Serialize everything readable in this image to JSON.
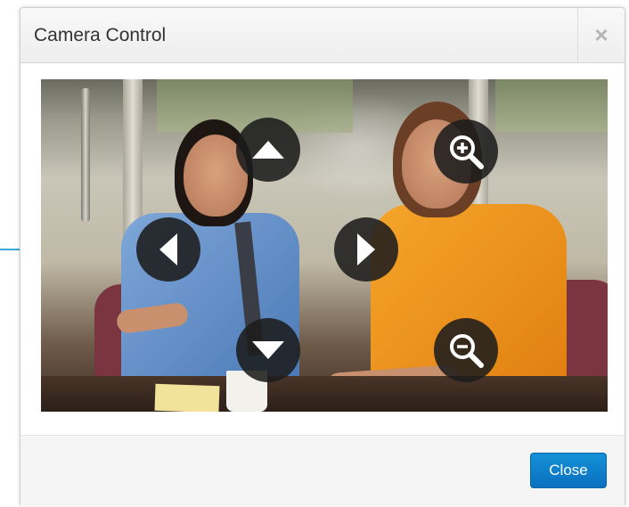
{
  "dialog": {
    "title": "Camera Control",
    "close_icon": "×",
    "close_button_label": "Close"
  },
  "video": {
    "description_icons": [
      "pan-up-icon",
      "pan-left-icon",
      "pan-right-icon",
      "pan-down-icon",
      "zoom-in-icon",
      "zoom-out-icon"
    ]
  },
  "colors": {
    "accent": "#0a70bf",
    "callout": "#3aa6d8",
    "control_bg": "#1c1c1c"
  }
}
